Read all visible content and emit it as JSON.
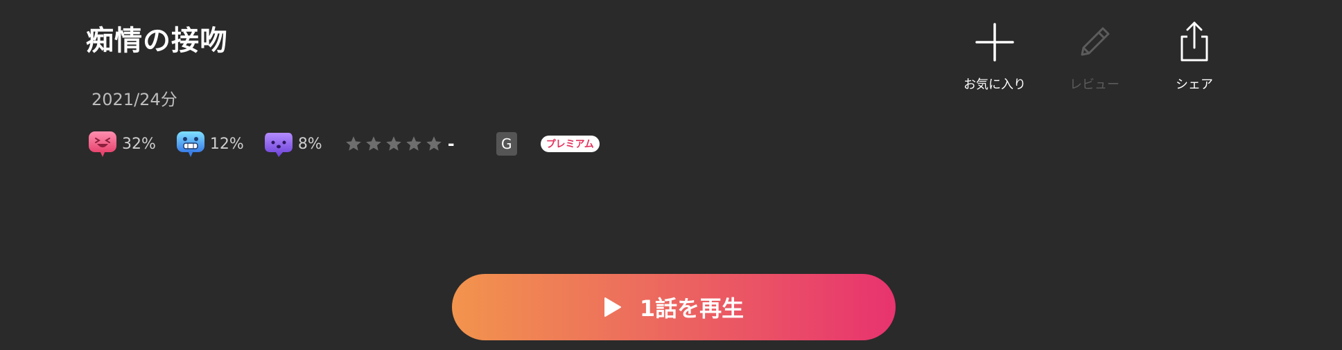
{
  "title": "痴情の接吻",
  "meta": "2021/24分",
  "reactions": [
    {
      "icon": "laughing-face-icon",
      "percent": "32%"
    },
    {
      "icon": "scared-face-icon",
      "percent": "12%"
    },
    {
      "icon": "ghost-face-icon",
      "percent": "8%"
    }
  ],
  "rating": {
    "stars_filled": 0,
    "stars_total": 5,
    "value": "-"
  },
  "age_rating": "G",
  "premium_label": "プレミアム",
  "actions": [
    {
      "label": "お気に入り",
      "icon": "plus-icon",
      "enabled": true
    },
    {
      "label": "レビュー",
      "icon": "pencil-icon",
      "enabled": false
    },
    {
      "label": "シェア",
      "icon": "share-icon",
      "enabled": true
    }
  ],
  "play_button": {
    "label": "1話を再生",
    "icon": "play-icon"
  },
  "colors": {
    "background": "#2a2a2a",
    "gradient_start": "#f2944d",
    "gradient_end": "#e8336f",
    "premium_text": "#e2335e",
    "disabled": "#5c5c5c"
  }
}
